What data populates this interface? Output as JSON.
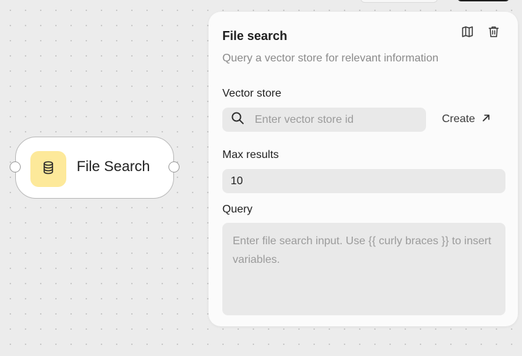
{
  "node": {
    "title": "File Search",
    "icon": "database-icon",
    "icon_bg": "#fde99a"
  },
  "panel": {
    "title": "File search",
    "description": "Query a vector store for relevant information",
    "actions": [
      "docs-icon",
      "trash-icon"
    ],
    "vector_store": {
      "label": "Vector store",
      "placeholder": "Enter vector store id",
      "create_label": "Create"
    },
    "max_results": {
      "label": "Max results",
      "value": "10"
    },
    "query": {
      "label": "Query",
      "placeholder": "Enter file search input. Use {{ curly braces }} to insert variables."
    }
  }
}
